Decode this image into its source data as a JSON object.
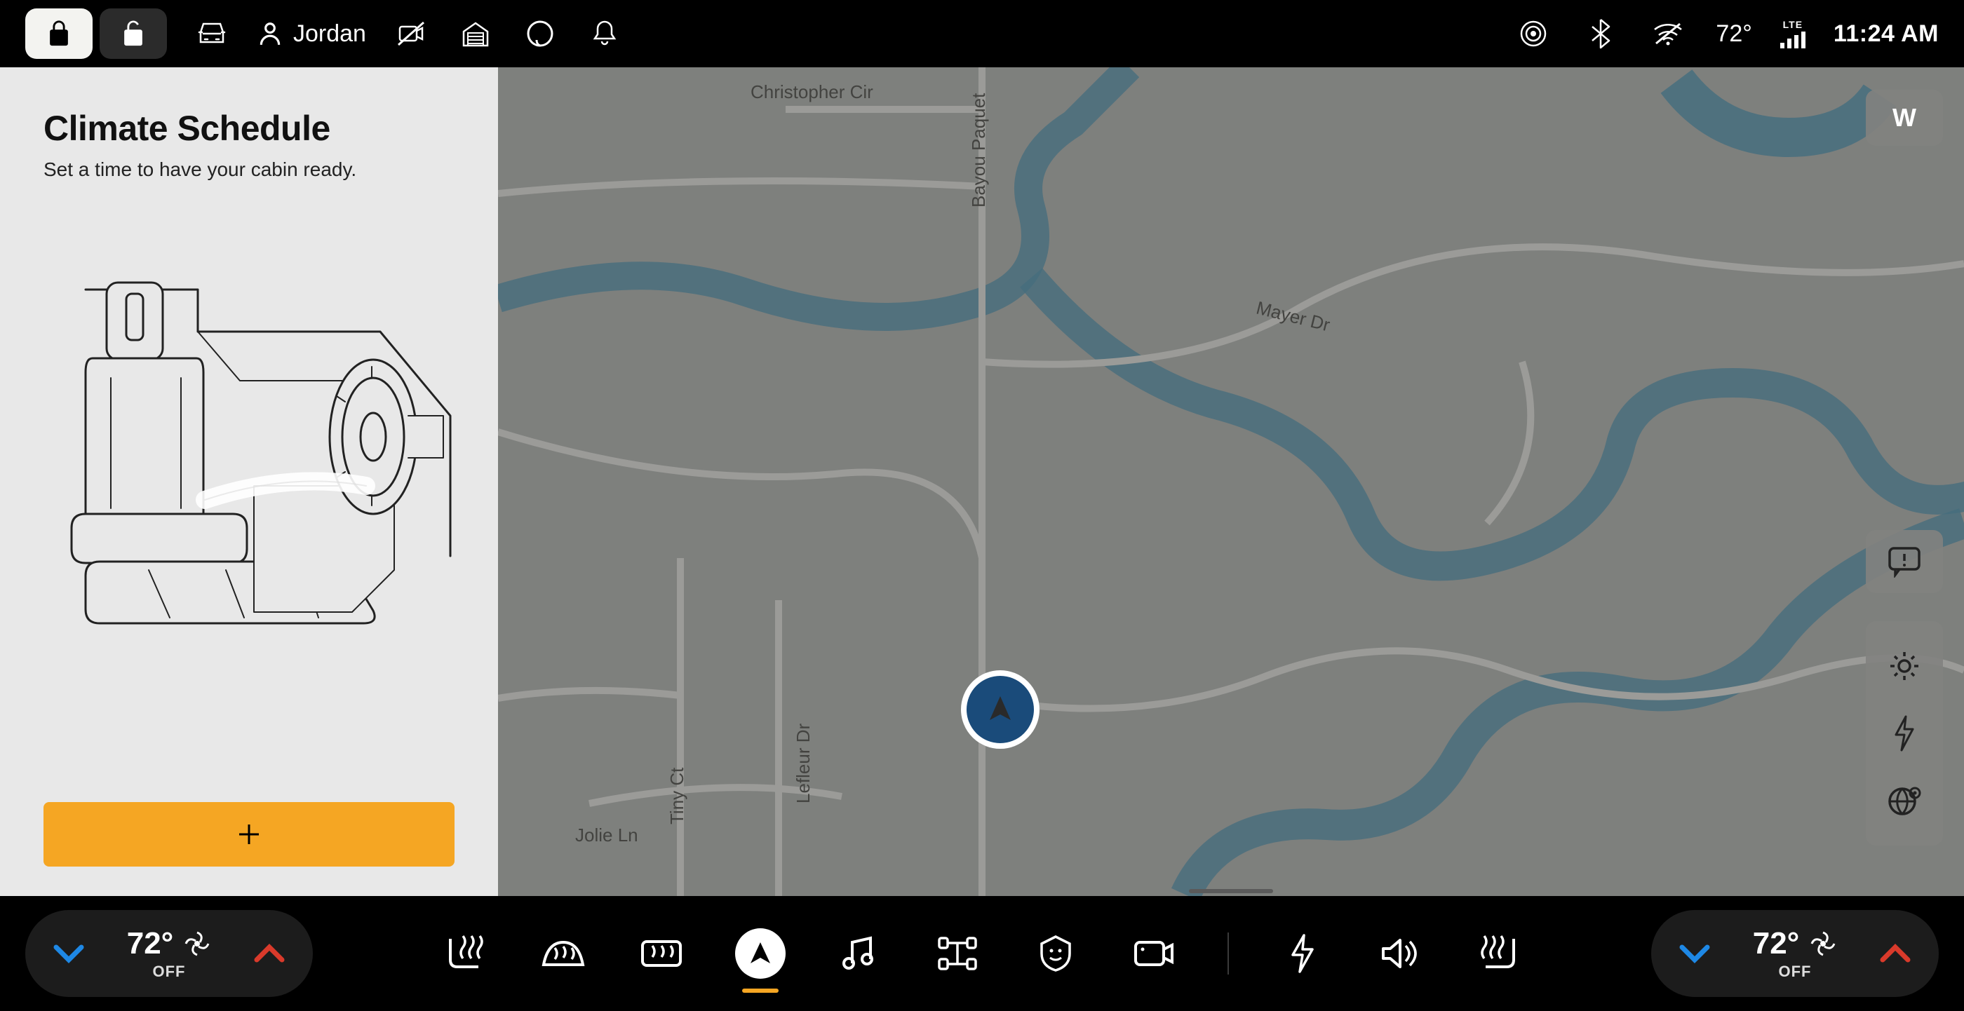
{
  "topbar": {
    "profile_name": "Jordan",
    "outside_temp": "72°",
    "network_label": "LTE",
    "clock": "11:24 AM"
  },
  "sidebar": {
    "title": "Climate Schedule",
    "subtitle": "Set a time to have your cabin ready.",
    "add_label": "+"
  },
  "map": {
    "compass": "W",
    "labels": {
      "christopher": "Christopher Cir",
      "bayou": "Bayou Paquet",
      "mayer": "Mayer Dr",
      "lefleur": "Lefleur Dr",
      "tiny": "Tiny Ct",
      "jolie": "Jolie Ln"
    }
  },
  "climate": {
    "left_temp": "72°",
    "left_state": "OFF",
    "right_temp": "72°",
    "right_state": "OFF"
  },
  "colors": {
    "accent": "#f5a623",
    "cool": "#1e88e5",
    "heat": "#d93a2b",
    "river": "#4a7b8f"
  }
}
